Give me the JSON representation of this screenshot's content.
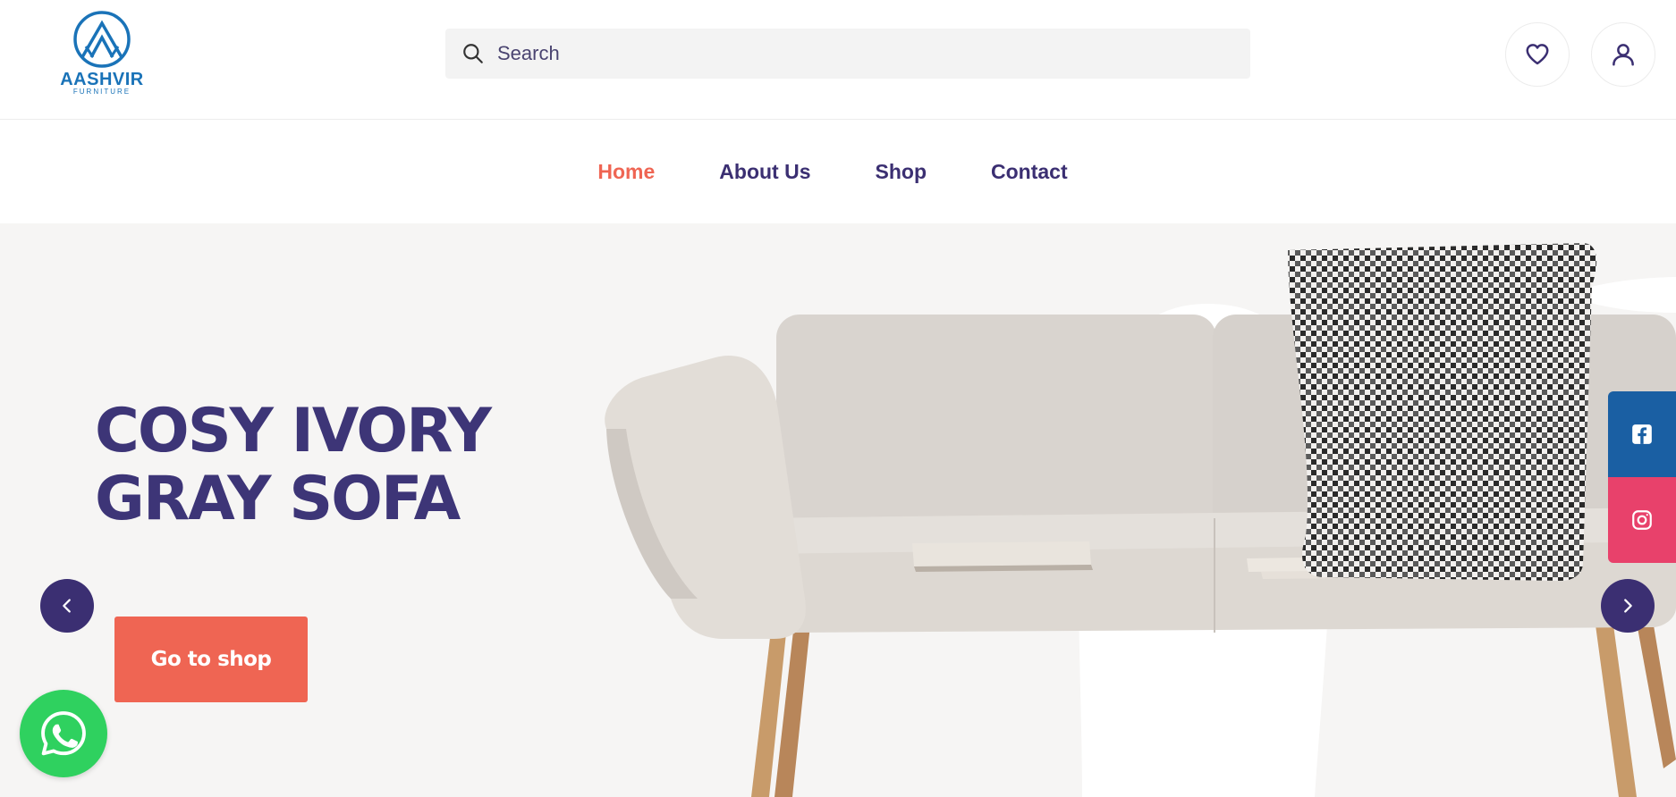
{
  "brand": {
    "name": "AASHVIR",
    "tagline": "FURNITURE"
  },
  "search": {
    "placeholder": "Search"
  },
  "header_icons": {
    "wishlist": "heart-icon",
    "account": "user-icon"
  },
  "nav": {
    "items": [
      {
        "label": "Home",
        "active": true
      },
      {
        "label": "About Us",
        "active": false
      },
      {
        "label": "Shop",
        "active": false
      },
      {
        "label": "Contact",
        "active": false
      }
    ]
  },
  "hero": {
    "title_line1": "COSY IVORY",
    "title_line2": "GRAY SOFA",
    "cta_label": "Go to shop"
  },
  "colors": {
    "primary": "#3b2f72",
    "accent": "#ef6553",
    "facebook": "#1a5fa3",
    "instagram": "#e8416b",
    "whatsapp": "#2fd15f",
    "brand_logo": "#1a73b8"
  },
  "social": [
    "facebook-icon",
    "instagram-icon"
  ],
  "floating": {
    "whatsapp": "whatsapp-icon"
  }
}
